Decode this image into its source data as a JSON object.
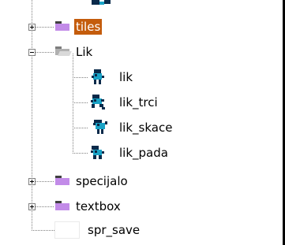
{
  "tree": {
    "nodes": [
      {
        "label": "tiles",
        "selected": true,
        "expanded": false,
        "icon": "folder-closed-icon"
      },
      {
        "label": "Lik",
        "selected": false,
        "expanded": true,
        "icon": "folder-open-icon"
      },
      {
        "label": "lik",
        "icon": "sprite-icon"
      },
      {
        "label": "lik_trci",
        "icon": "sprite-icon"
      },
      {
        "label": "lik_skace",
        "icon": "sprite-icon"
      },
      {
        "label": "lik_pada",
        "icon": "sprite-icon"
      },
      {
        "label": "specijalo",
        "selected": false,
        "expanded": false,
        "icon": "folder-closed-icon"
      },
      {
        "label": "textbox",
        "selected": false,
        "expanded": false,
        "icon": "folder-closed-icon"
      },
      {
        "label": "spr_save",
        "icon": "blank-sprite-icon"
      }
    ]
  },
  "colors": {
    "selection": "#c45c0c",
    "folder": "#c28be8",
    "sprite_body": "#19a3c7",
    "sprite_dark": "#0a2a4a"
  }
}
